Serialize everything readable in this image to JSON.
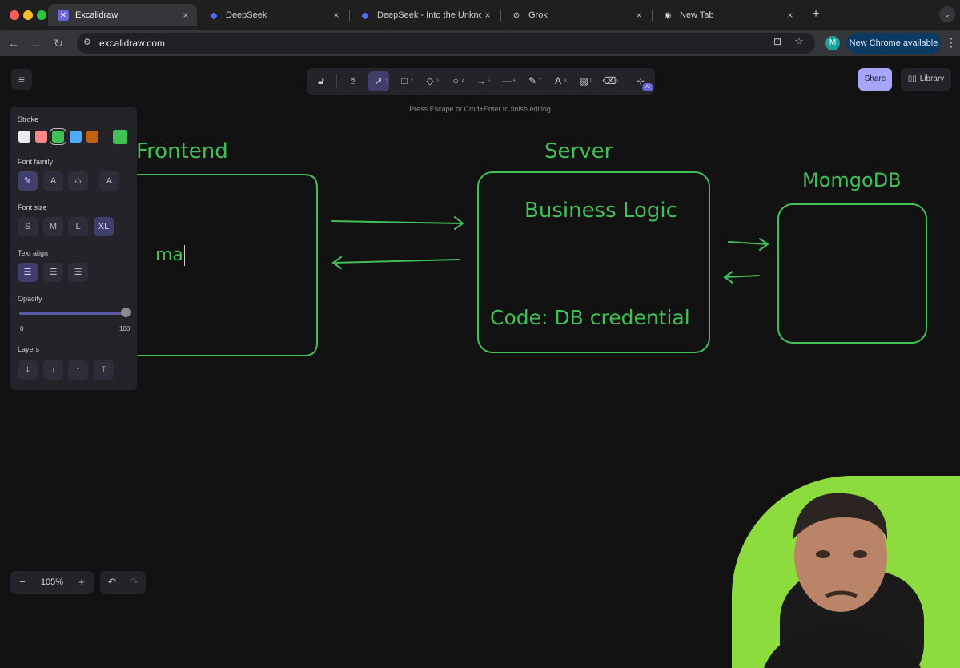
{
  "browser": {
    "tabs": [
      {
        "label": "Excalidraw",
        "icon": "excalidraw-favicon"
      },
      {
        "label": "DeepSeek",
        "icon": "deepseek-favicon"
      },
      {
        "label": "DeepSeek - Into the Unknown",
        "icon": "deepseek-favicon"
      },
      {
        "label": "Grok",
        "icon": "grok-favicon"
      },
      {
        "label": "New Tab",
        "icon": "chrome-favicon"
      }
    ],
    "url": "excalidraw.com",
    "avatar_letter": "M",
    "update_label": "New Chrome available"
  },
  "excalidraw": {
    "hint": "Press Escape or Cmd+Enter to finish editing",
    "share_label": "Share",
    "library_label": "Library",
    "toolbar": [
      "lock",
      "hand",
      "selection",
      "rectangle",
      "diamond",
      "ellipse",
      "arrow",
      "line",
      "draw",
      "text",
      "image",
      "eraser",
      "more-tools"
    ],
    "tool_shortcuts": [
      "1",
      "2",
      "3",
      "4",
      "5",
      "6",
      "7",
      "8",
      "9",
      "0"
    ],
    "ai_badge": "AI",
    "panel": {
      "stroke_label": "Stroke",
      "stroke_colors": [
        "#e9ecef",
        "#ff8787",
        "#40c057",
        "#4dabf7",
        "#c2600d"
      ],
      "current_stroke": "#40c057",
      "font_family_label": "Font family",
      "font_size_label": "Font size",
      "font_sizes": [
        "S",
        "M",
        "L",
        "XL"
      ],
      "selected_font_size": "XL",
      "text_align_label": "Text align",
      "opacity_label": "Opacity",
      "opacity_min": "0",
      "opacity_max": "100",
      "opacity_value": 100,
      "layers_label": "Layers"
    },
    "zoom": "105%"
  },
  "drawing": {
    "frontend_title": "Frontend",
    "server_title": "Server",
    "business_logic": "Business Logic",
    "code_text": "Code: DB credential",
    "db_title": "MomgoDB",
    "editing_text": "ma"
  }
}
